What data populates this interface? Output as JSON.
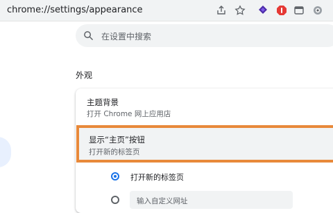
{
  "browser": {
    "url": "chrome://settings/appearance"
  },
  "search": {
    "placeholder": "在设置中搜索"
  },
  "section": {
    "title": "外观"
  },
  "theme": {
    "title": "主题背景",
    "subtitle": "打开 Chrome 网上应用店"
  },
  "home_button": {
    "title": "显示“主页”按钮",
    "subtitle": "打开新的标签页"
  },
  "radio_options": {
    "new_tab_label": "打开新的标签页",
    "custom_url_placeholder": "输入自定义网址"
  },
  "colors": {
    "accent": "#1a73e8",
    "highlight_border": "#e8893a"
  },
  "icons": [
    "share-icon",
    "star-icon",
    "extension-purple-icon",
    "adblock-red-icon",
    "tab-icon",
    "extension-gear-icon"
  ]
}
